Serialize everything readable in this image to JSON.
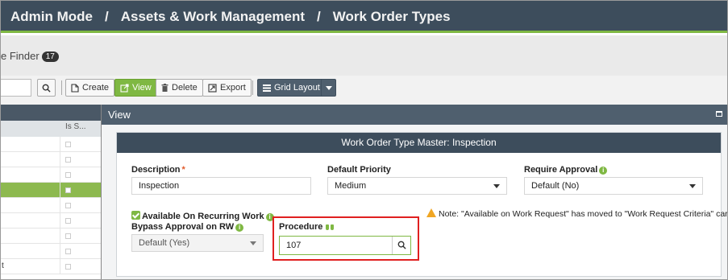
{
  "breadcrumb": [
    "Admin Mode",
    "Assets & Work Management",
    "Work Order Types"
  ],
  "breadcrumb_sep": "/",
  "finder": {
    "label": "e Finder",
    "count": "17"
  },
  "toolbar": {
    "create": "Create",
    "view": "View",
    "delete": "Delete",
    "export": "Export",
    "grid_layout": "Grid Layout"
  },
  "grid": {
    "column_header": "Is S...",
    "last_row_text": "t"
  },
  "modal": {
    "title": "View",
    "card_title": "Work Order Type Master: Inspection",
    "description": {
      "label": "Description",
      "required_mark": "*",
      "value": "Inspection"
    },
    "default_priority": {
      "label": "Default Priority",
      "value": "Medium"
    },
    "require_approval": {
      "label": "Require Approval",
      "value": "Default (No)"
    },
    "available_recurring": {
      "label": "Available On Recurring Work",
      "checked": true
    },
    "bypass_approval": {
      "label": "Bypass Approval on RW",
      "value": "Default (Yes)"
    },
    "procedure": {
      "label": "Procedure",
      "value": "107"
    },
    "note": "Note: \"Available on Work Request\" has moved to \"Work Request Criteria\" card",
    "info_glyph": "i"
  },
  "colors": {
    "header": "#3d4d5c",
    "accent": "#7fb843",
    "highlight": "#e02020",
    "warning": "#f0a623"
  },
  "icons": [
    "search-icon",
    "create-icon",
    "view-icon",
    "delete-icon",
    "export-icon",
    "grid-layout-icon",
    "dropdown-caret-icon",
    "maximize-icon",
    "info-icon",
    "warning-icon",
    "binoculars-icon"
  ]
}
